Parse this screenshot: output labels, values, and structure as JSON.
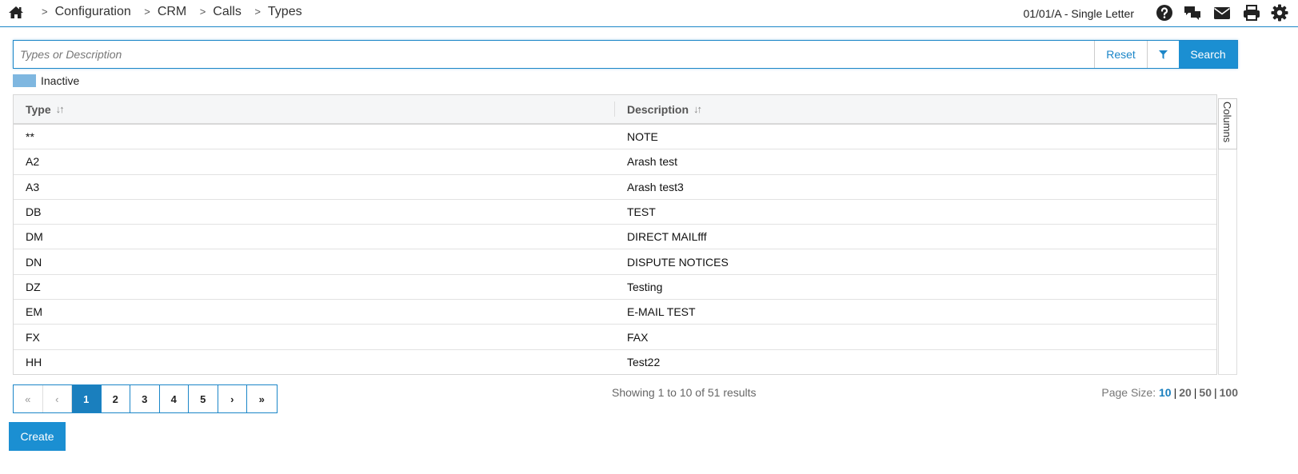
{
  "breadcrumb": {
    "items": [
      "Configuration",
      "CRM",
      "Calls",
      "Types"
    ],
    "separator": ">"
  },
  "header": {
    "context_label": "01/01/A - Single Letter"
  },
  "search": {
    "placeholder": "Types or Description",
    "value": "",
    "reset_label": "Reset",
    "search_label": "Search"
  },
  "legend": {
    "inactive_label": "Inactive",
    "inactive_color": "#7fb7e0"
  },
  "table": {
    "columns": [
      "Type",
      "Description"
    ],
    "side_tab_label": "Columns",
    "rows": [
      [
        "**",
        "NOTE"
      ],
      [
        "A2",
        "Arash test"
      ],
      [
        "A3",
        "Arash test3"
      ],
      [
        "DB",
        "TEST"
      ],
      [
        "DM",
        "DIRECT MAILfff"
      ],
      [
        "DN",
        "DISPUTE NOTICES"
      ],
      [
        "DZ",
        "Testing"
      ],
      [
        "EM",
        "E-MAIL TEST"
      ],
      [
        "FX",
        "FAX"
      ],
      [
        "HH",
        "Test22"
      ]
    ]
  },
  "pagination": {
    "first": "«",
    "prev": "‹",
    "pages": [
      "1",
      "2",
      "3",
      "4",
      "5"
    ],
    "active_page": "1",
    "next": "›",
    "last": "»",
    "summary": "Showing 1 to 10 of 51 results",
    "page_size_label": "Page Size:",
    "page_sizes": [
      "10",
      "20",
      "50",
      "100"
    ],
    "selected_page_size": "10"
  },
  "actions": {
    "create_label": "Create"
  },
  "colors": {
    "accent": "#1b8fd2",
    "active_page": "#1a7fbe"
  },
  "icons": {
    "home": "home-icon",
    "help": "help-icon",
    "chat": "chat-icon",
    "mail": "mail-icon",
    "print": "print-icon",
    "settings": "gear-icon",
    "filter": "filter-icon"
  }
}
